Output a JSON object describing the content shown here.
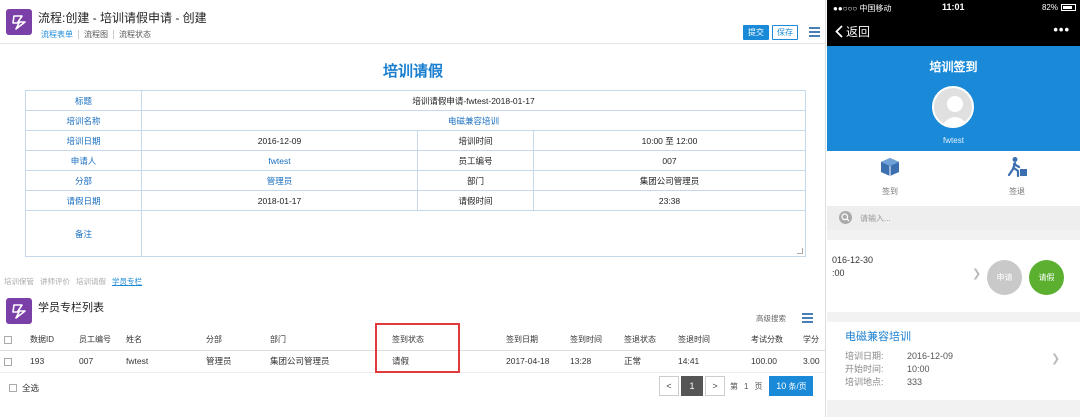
{
  "desktop": {
    "title": "流程:创建 - 培训请假申请 - 创建",
    "tabs": [
      "流程表单",
      "流程图",
      "流程状态"
    ],
    "buttons": {
      "submit": "提交",
      "save": "保存"
    },
    "form_title": "培训请假",
    "form": {
      "title_label": "标题",
      "title_value": "培训请假申请-fwtest-2018-01-17",
      "training_name_label": "培训名称",
      "training_name_value": "电磁兼容培训",
      "training_date_label": "培训日期",
      "training_date_value": "2016-12-09",
      "training_time_label": "培训时间",
      "training_time_value": "10:00 至 12:00",
      "applicant_label": "申请人",
      "applicant_value": "fwtest",
      "employee_no_label": "员工编号",
      "employee_no_value": "007",
      "division_label": "分部",
      "division_value": "管理员",
      "department_label": "部门",
      "department_value": "集团公司管理员",
      "leave_date_label": "请假日期",
      "leave_date_value": "2018-01-17",
      "leave_time_label": "请假时间",
      "leave_time_value": "23:38",
      "remark_label": "备注"
    },
    "sub_tabs": [
      "培训保管",
      "讲师评价",
      "培训请假",
      "学员专栏"
    ],
    "list": {
      "title": "学员专栏列表",
      "search_label": "高级搜索",
      "columns": [
        "数据ID",
        "员工编号",
        "姓名",
        "分部",
        "部门",
        "签到状态",
        "签到日期",
        "签到时间",
        "签退状态",
        "签退时间",
        "考试分数",
        "学分"
      ],
      "rows": [
        [
          "193",
          "007",
          "fwtest",
          "管理员",
          "集团公司管理员",
          "请假",
          "2017-04-18",
          "13:28",
          "正常",
          "14:41",
          "100.00",
          "3.00"
        ]
      ],
      "select_all": "全选"
    },
    "pager": {
      "prev": "<",
      "current": "1",
      "next": ">",
      "goto_prefix": "第",
      "goto_page": "1",
      "goto_suffix": "页",
      "page_size": "10",
      "page_size_unit": "条/页"
    }
  },
  "mobile": {
    "status": {
      "carrier": "●●○○○ 中国移动",
      "time": "11:01",
      "battery": "82%"
    },
    "nav": {
      "back": "返回",
      "more": "•••"
    },
    "hero": {
      "title": "培训签到",
      "user": "fwtest"
    },
    "actions": {
      "sign_in": "签到",
      "sign_out": "签退"
    },
    "search_placeholder": "请输入...",
    "card1": {
      "date": "016-12-30",
      "time": ":00",
      "apply": "申请",
      "leave": "请假"
    },
    "card2": {
      "title": "电磁兼容培训",
      "date_label": "培训日期:",
      "date_value": "2016-12-09",
      "start_label": "开始时间:",
      "start_value": "10:00",
      "location_label": "培训地点:",
      "location_value": "333"
    }
  },
  "colors": {
    "brand_blue": "#1a8ad8",
    "logo_purple": "#7b3fa8",
    "highlight_red": "#e03a3a",
    "leave_green": "#5bb030"
  }
}
